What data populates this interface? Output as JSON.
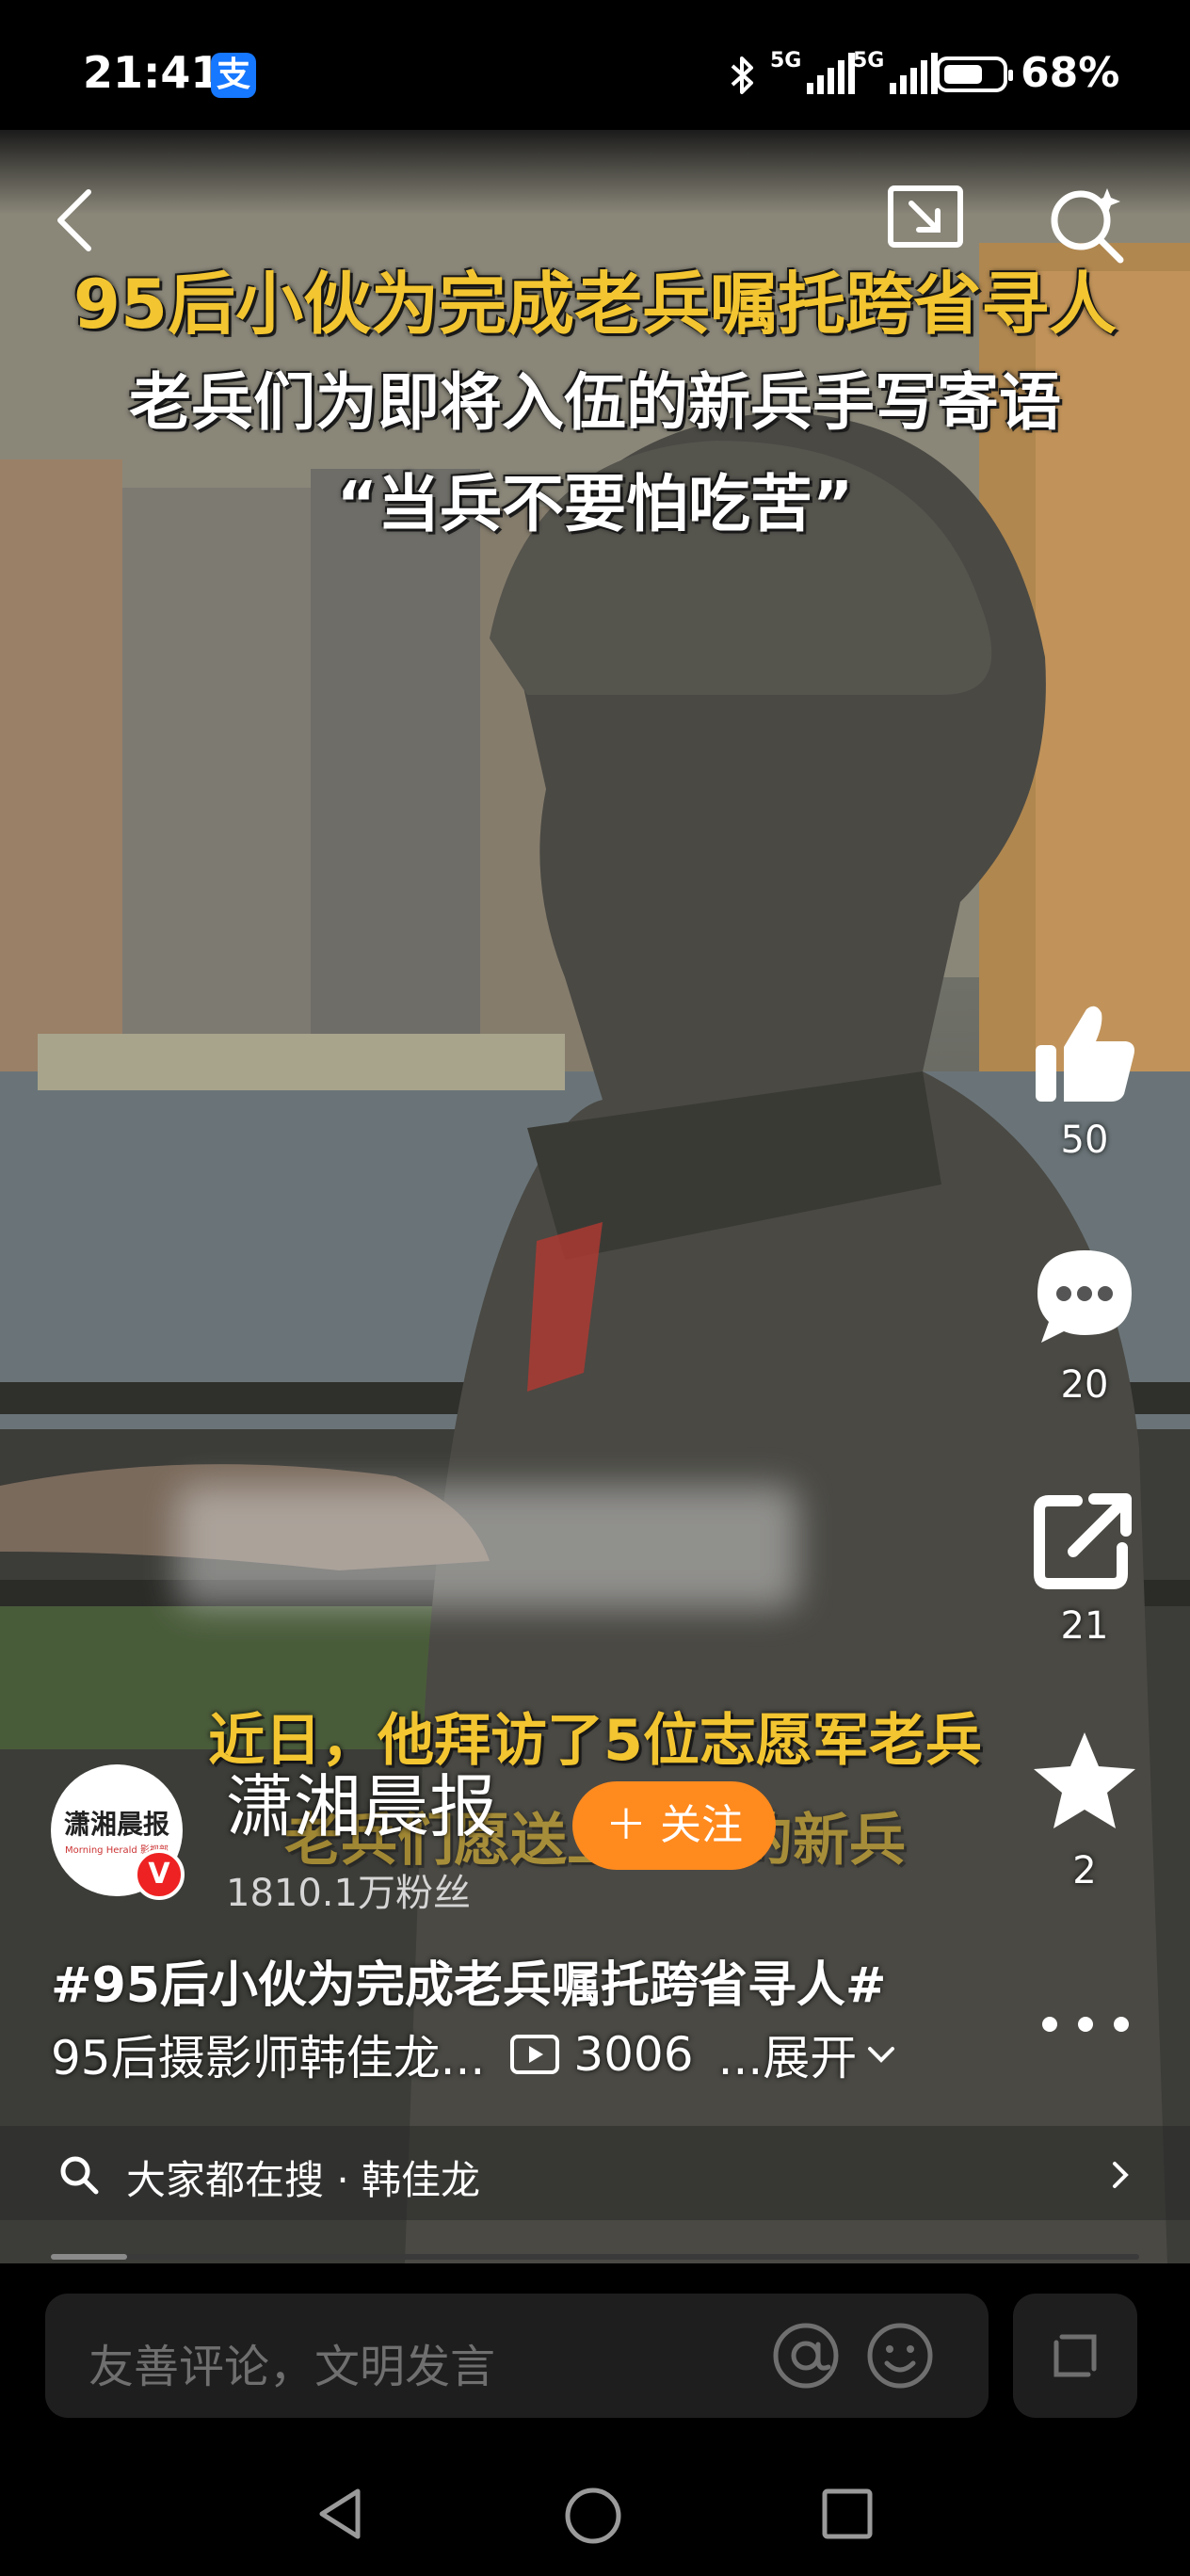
{
  "status_bar": {
    "time": "21:41",
    "alipay_glyph": "支",
    "network_1": "5G",
    "network_2": "5G",
    "battery": "68%",
    "icons": [
      "alipay-icon",
      "bluetooth-icon",
      "signal-icon",
      "battery-icon"
    ]
  },
  "video": {
    "overlay_title": "95后小伙为完成老兵嘱托跨省寻人",
    "overlay_line2": "老兵们为即将入伍的新兵手写寄语",
    "overlay_line3": "“当兵不要怕吃苦”",
    "subtitle_1": "近日，他拜访了5位志愿军老兵",
    "subtitle_2": "老兵们愿送上入伍的新兵"
  },
  "actions": {
    "likes": "50",
    "comments": "20",
    "shares": "21",
    "favorites": "2"
  },
  "author": {
    "avatar_text": "潇湘晨报",
    "avatar_sub": "Morning Herald 影视部",
    "verified": "V",
    "name": "潇湘晨报",
    "follow_label": "＋ 关注",
    "followers": "1810.1万粉丝"
  },
  "description": {
    "hashtag_title": "#95后小伙为完成老兵嘱托跨省寻人#",
    "text": "95后摄影师韩佳龙...",
    "plays": "3006",
    "expand": "...展开"
  },
  "search_suggestion": {
    "text": "大家都在搜 · 韩佳龙"
  },
  "progress": {
    "fraction": 0.07
  },
  "comment_bar": {
    "placeholder": "友善评论，文明发言"
  },
  "colors": {
    "accent_orange": "#ff8a1e",
    "title_yellow": "#f2c531",
    "verified_red": "#e22222"
  }
}
